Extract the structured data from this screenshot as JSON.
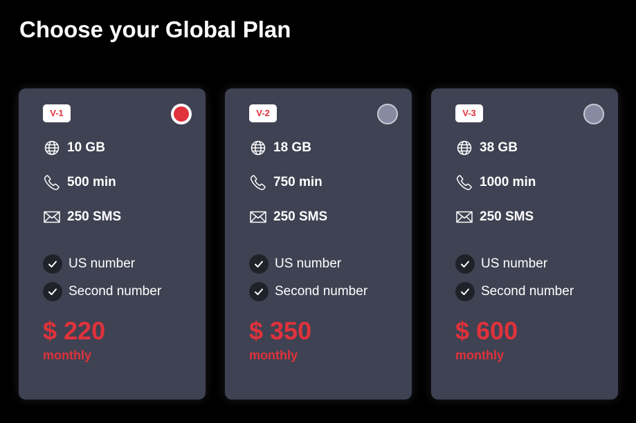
{
  "page": {
    "title": "Choose your Global Plan"
  },
  "colors": {
    "background": "#000000",
    "card": "#3f4252",
    "accent": "#e0323c",
    "radio_unselected": "#878aa0",
    "check_bg": "#20222a"
  },
  "plans": [
    {
      "badge": "V-1",
      "selected": true,
      "data": "10 GB",
      "minutes": "500 min",
      "sms": "250 SMS",
      "features": [
        "US number",
        "Second number"
      ],
      "price": "$ 220",
      "period": "monthly"
    },
    {
      "badge": "V-2",
      "selected": false,
      "data": "18 GB",
      "minutes": "750 min",
      "sms": "250 SMS",
      "features": [
        "US number",
        "Second number"
      ],
      "price": "$ 350",
      "period": "monthly"
    },
    {
      "badge": "V-3",
      "selected": false,
      "data": "38 GB",
      "minutes": "1000 min",
      "sms": "250 SMS",
      "features": [
        "US number",
        "Second number"
      ],
      "price": "$ 600",
      "period": "monthly"
    }
  ],
  "icons": {
    "data": "globe-icon",
    "minutes": "phone-icon",
    "sms": "envelope-icon",
    "feature": "checkmark-icon",
    "radio": "radio-button"
  }
}
